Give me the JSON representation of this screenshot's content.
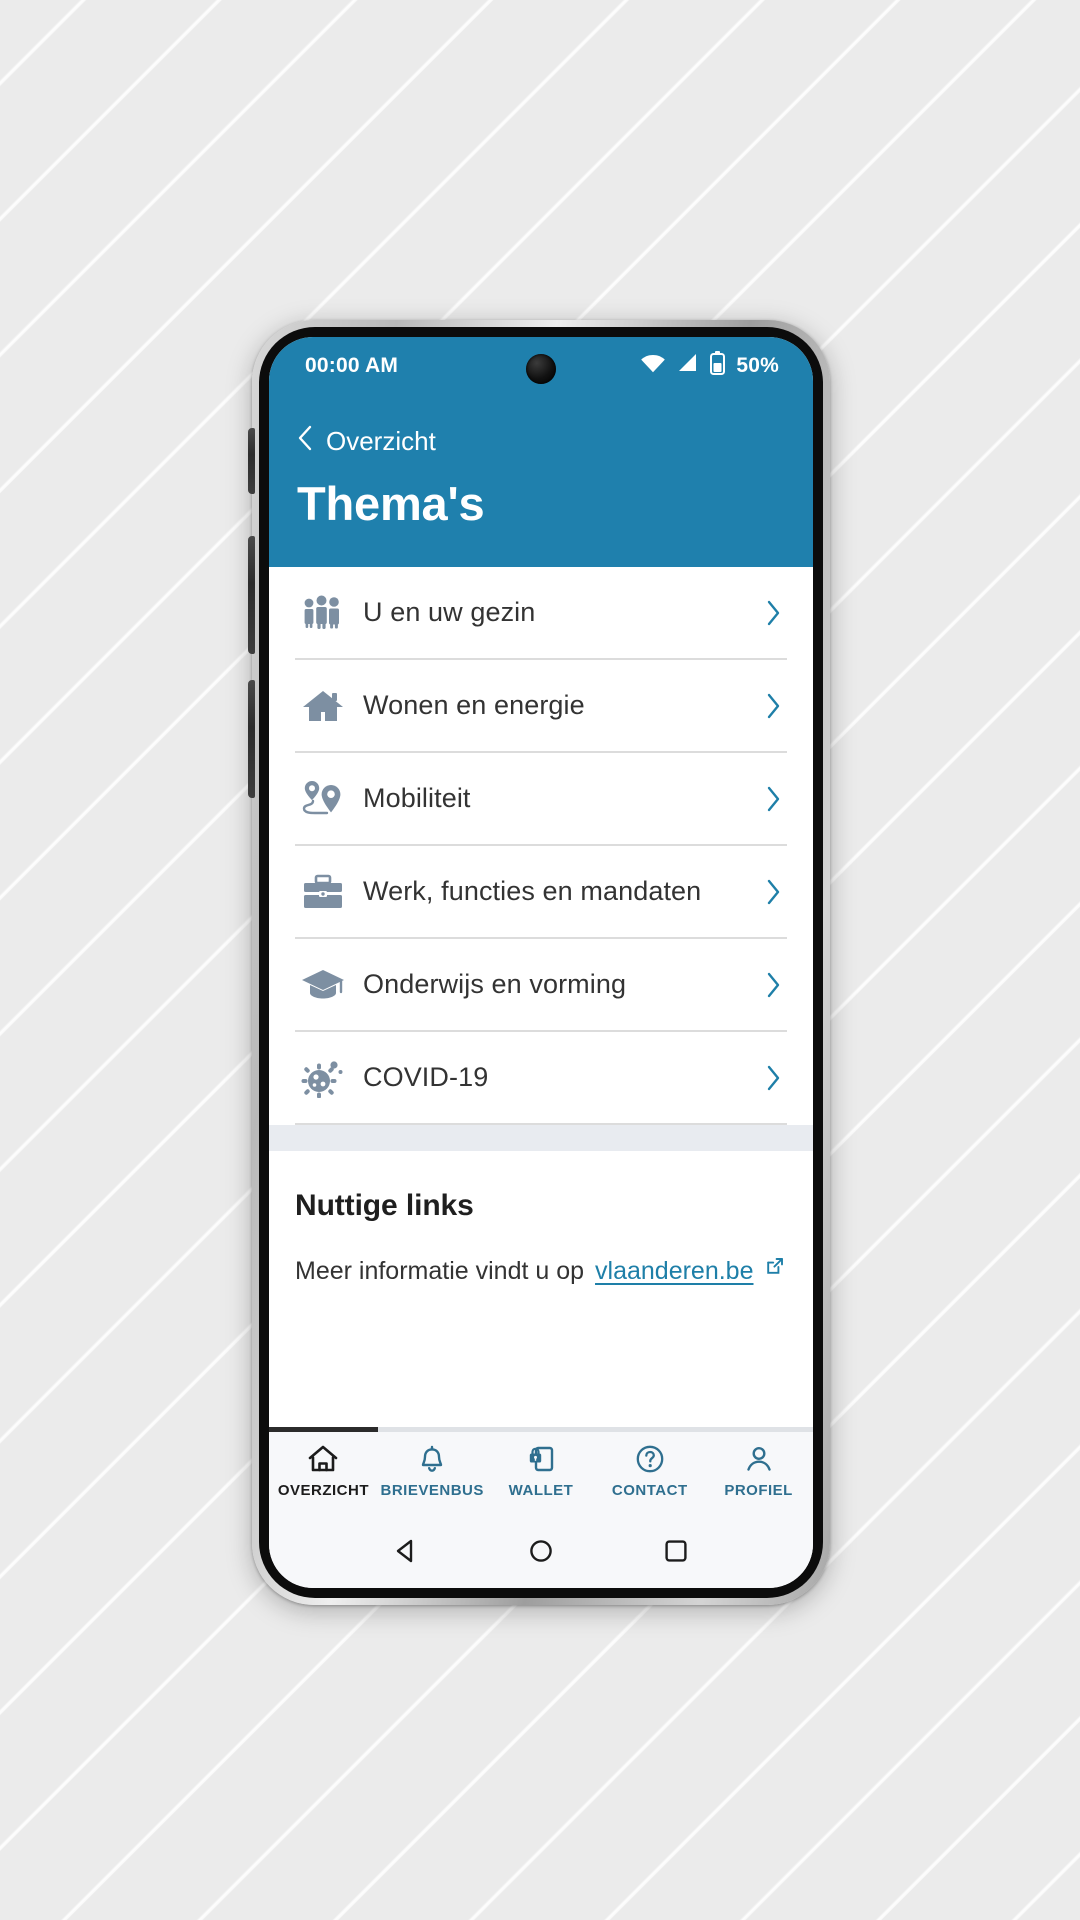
{
  "statusbar": {
    "time": "00:00 AM",
    "wifi_icon": "wifi-icon",
    "signal_icon": "cellular-signal-icon",
    "battery_icon": "battery-icon",
    "battery_label": "50%"
  },
  "header": {
    "back_label": "Overzicht",
    "back_icon": "chevron-left-icon",
    "title": "Thema's",
    "background_color": "#1f80ad"
  },
  "themes": {
    "items": [
      {
        "label": "U en uw gezin",
        "icon": "family-icon"
      },
      {
        "label": "Wonen en energie",
        "icon": "house-icon"
      },
      {
        "label": "Mobiliteit",
        "icon": "map-pin-route-icon"
      },
      {
        "label": "Werk, functies en mandaten",
        "icon": "briefcase-icon"
      },
      {
        "label": "Onderwijs en vorming",
        "icon": "graduation-cap-icon"
      },
      {
        "label": "COVID-19",
        "icon": "virus-icon"
      }
    ],
    "chevron_icon": "chevron-right-icon",
    "icon_color": "#7d8fa2",
    "chevron_color": "#1e7fa8"
  },
  "links": {
    "title": "Nuttige links",
    "text_prefix": "Meer informatie vindt u op",
    "link_label": "vlaanderen.be",
    "external_icon": "external-link-icon",
    "link_color": "#1e7fa8"
  },
  "tabbar": {
    "active_index": 0,
    "items": [
      {
        "label": "OVERZICHT",
        "icon": "home-icon"
      },
      {
        "label": "BRIEVENBUS",
        "icon": "bell-icon"
      },
      {
        "label": "WALLET",
        "icon": "locked-card-icon"
      },
      {
        "label": "CONTACT",
        "icon": "question-circle-icon"
      },
      {
        "label": "PROFIEL",
        "icon": "person-icon"
      }
    ],
    "active_color": "#1c1c1c",
    "inactive_color": "#2f6f8f"
  },
  "androidnav": {
    "back_icon": "android-back-icon",
    "home_icon": "android-home-icon",
    "recents_icon": "android-recents-icon"
  }
}
